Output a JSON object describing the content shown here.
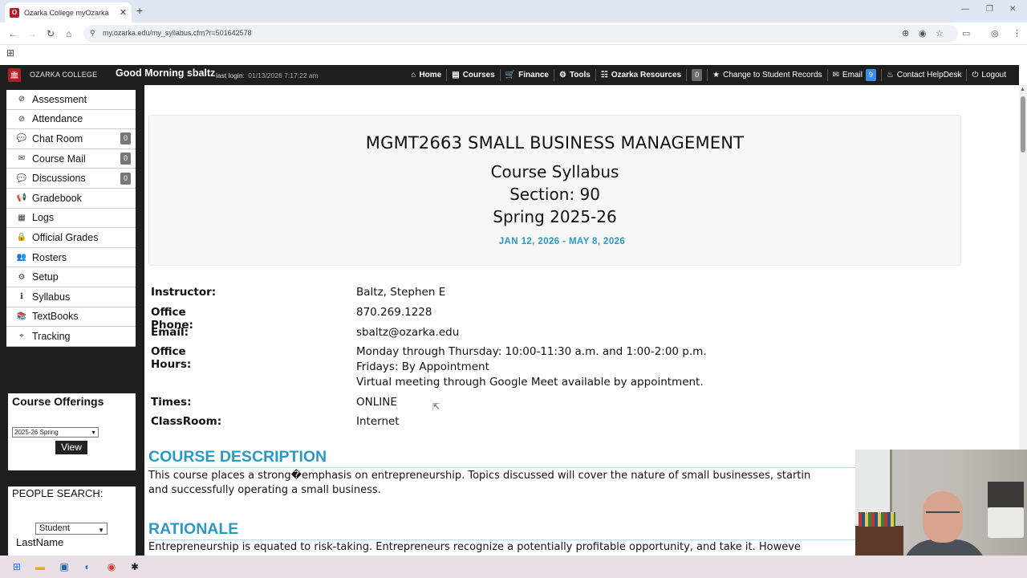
{
  "browser": {
    "tab_title": "Ozarka College myOzarka",
    "tab_favicon": "O",
    "new_tab": "+",
    "tab_close": "✕",
    "url": "my.ozarka.edu/my_syllabus.cfm?r=501642578"
  },
  "header": {
    "college": "OZARKA COLLEGE",
    "greeting": "Good Morning sbaltz",
    "last_login_label": "last login:",
    "last_login_value": "01/13/2026 7:17:22 am",
    "nav": [
      {
        "icon": "home-icon",
        "glyph": "⌂",
        "label": "Home"
      },
      {
        "icon": "book-icon",
        "glyph": "▤",
        "label": "Courses"
      },
      {
        "icon": "cart-icon",
        "glyph": "🛒",
        "label": "Finance"
      },
      {
        "icon": "gear-icon",
        "glyph": "⚙",
        "label": "Tools"
      },
      {
        "icon": "list-icon",
        "glyph": "☷",
        "label": "Ozarka Resources"
      },
      {
        "icon": "star-icon",
        "glyph": "★",
        "label": "Change to Student Records"
      },
      {
        "icon": "mail-icon",
        "glyph": "✉",
        "label": "Email"
      },
      {
        "icon": "fire-icon",
        "glyph": "♨",
        "label": "Contact HelpDesk"
      },
      {
        "icon": "power-icon",
        "glyph": "⏻",
        "label": "Logout"
      }
    ],
    "resources_count": "0",
    "email_count": "9"
  },
  "sidebar": {
    "items": [
      {
        "icon": "clock-icon",
        "glyph": "⊘",
        "label": "Assessment",
        "count": ""
      },
      {
        "icon": "clock-icon",
        "glyph": "⊘",
        "label": "Attendance",
        "count": ""
      },
      {
        "icon": "chat-icon",
        "glyph": "💬",
        "label": "Chat Room",
        "count": "0"
      },
      {
        "icon": "envelope-icon",
        "glyph": "✉",
        "label": "Course Mail",
        "count": "0"
      },
      {
        "icon": "comments-icon",
        "glyph": "💬",
        "label": "Discussions",
        "count": "0"
      },
      {
        "icon": "bullhorn-icon",
        "glyph": "📢",
        "label": "Gradebook",
        "count": ""
      },
      {
        "icon": "table-icon",
        "glyph": "▦",
        "label": "Logs",
        "count": ""
      },
      {
        "icon": "lock-icon",
        "glyph": "🔒",
        "label": "Official Grades",
        "count": ""
      },
      {
        "icon": "users-icon",
        "glyph": "👥",
        "label": "Rosters",
        "count": ""
      },
      {
        "icon": "cogs-icon",
        "glyph": "⚙",
        "label": "Setup",
        "count": ""
      },
      {
        "icon": "info-icon",
        "glyph": "ℹ",
        "label": "Syllabus",
        "count": ""
      },
      {
        "icon": "books-icon",
        "glyph": "📚",
        "label": "TextBooks",
        "count": ""
      },
      {
        "icon": "crosshairs-icon",
        "glyph": "⌖",
        "label": "Tracking",
        "count": ""
      }
    ],
    "offerings_title": "Course Offerings",
    "offerings_selected": "2025-26 Spring",
    "view_label": "View",
    "people_title": "PEOPLE SEARCH:",
    "people_selected": "Student",
    "lastname_label": "LastName"
  },
  "syllabus": {
    "course_title": "MGMT2663 SMALL BUSINESS MANAGEMENT",
    "doc_type": "Course Syllabus",
    "section": "Section: 90",
    "term": "Spring 2025-26",
    "dates": "JAN 12, 2026 - MAY 8, 2026",
    "info": [
      {
        "label": "Instructor:",
        "value": "Baltz, Stephen E"
      },
      {
        "label": "Office Phone:",
        "value": "870.269.1228"
      },
      {
        "label": "Email:",
        "value": "sbaltz@ozarka.edu"
      },
      {
        "label": "Office Hours:",
        "value": "Monday through Thursday: 10:00-11:30 a.m. and 1:00-2:00 p.m."
      }
    ],
    "office_hours_extra": [
      "Fridays: By Appointment",
      "Virtual meeting through Google Meet available by appointment."
    ],
    "info2": [
      {
        "label": "Times:",
        "value": "ONLINE"
      },
      {
        "label": "ClassRoom:",
        "value": "Internet"
      }
    ],
    "description_heading": "COURSE DESCRIPTION",
    "description_line1": "This course places a strong�emphasis on entrepreneurship. Topics discussed will cover the nature of small businesses, startin",
    "description_line2": "and successfully operating a small business.",
    "rationale_heading": "RATIONALE",
    "rationale_line1": "Entrepreneurship is equated to risk-taking. Entrepreneurs recognize a potentially profitable opportunity, and take it. Howeve"
  },
  "colors": {
    "accent": "#2a9ac5",
    "header_bg": "#1e1e1e",
    "brand": "#b01e23"
  }
}
